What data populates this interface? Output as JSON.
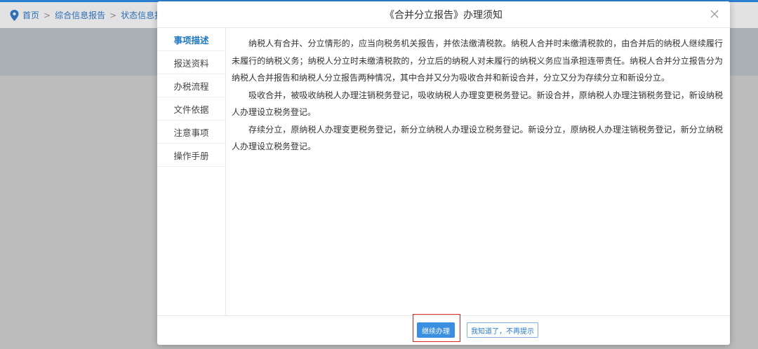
{
  "breadcrumb": {
    "items": [
      "首页",
      "综合信息报告",
      "状态信息报告"
    ],
    "separator": ">"
  },
  "modal": {
    "title": "《合并分立报告》办理须知",
    "close_icon": "close-icon",
    "tabs": [
      {
        "label": "事项描述",
        "active": true
      },
      {
        "label": "报送资料",
        "active": false
      },
      {
        "label": "办税流程",
        "active": false
      },
      {
        "label": "文件依据",
        "active": false
      },
      {
        "label": "注意事项",
        "active": false
      },
      {
        "label": "操作手册",
        "active": false
      }
    ],
    "paragraphs": [
      "纳税人有合并、分立情形的，应当向税务机关报告，并依法缴清税款。纳税人合并时未缴清税款的，由合并后的纳税人继续履行未履行的纳税义务；纳税人分立时未缴清税款的，分立后的纳税人对未履行的纳税义务应当承担连带责任。纳税人合并分立报告分为纳税人合并报告和纳税人分立报告两种情况，其中合并又分为吸收合并和新设合并，分立又分为存续分立和新设分立。",
      "吸收合并，被吸收纳税人办理注销税务登记，吸收纳税人办理变更税务登记。新设合并，原纳税人办理注销税务登记，新设纳税人办理设立税务登记。",
      "存续分立，原纳税人办理变更税务登记，新分立纳税人办理设立税务登记。新设分立，原纳税人办理注销税务登记，新分立纳税人办理设立税务登记。"
    ],
    "buttons": {
      "continue_label": "继续办理",
      "dismiss_label": "我知道了，不再提示"
    }
  },
  "colors": {
    "accent": "#1e78c8",
    "primary_button": "#3b8fe0",
    "highlight": "#d9241c"
  }
}
